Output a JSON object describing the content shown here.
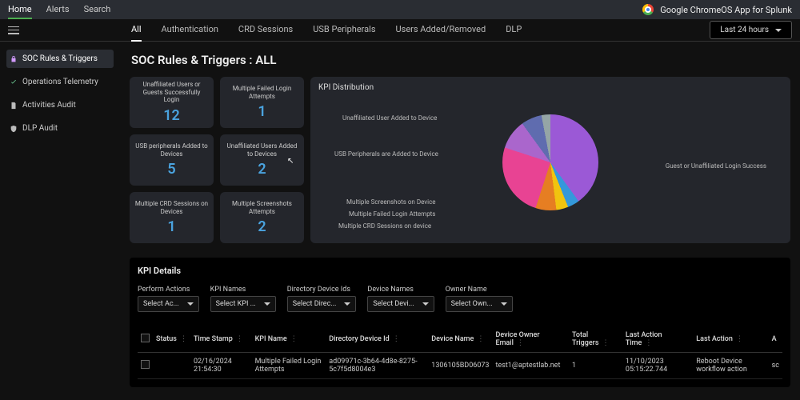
{
  "top_nav": {
    "items": [
      "Home",
      "Alerts",
      "Search"
    ],
    "active": 0
  },
  "app_brand": "Google ChromeOS App for Splunk",
  "tab_bar": {
    "tabs": [
      "All",
      "Authentication",
      "CRD Sessions",
      "USB Peripherals",
      "Users Added/Removed",
      "DLP"
    ],
    "active": 0
  },
  "time_range": "Last 24 hours",
  "sidebar": {
    "items": [
      {
        "label": "SOC Rules & Triggers",
        "icon": "lock-icon",
        "active": true
      },
      {
        "label": "Operations Telemetry",
        "icon": "check-icon",
        "active": false
      },
      {
        "label": "Activities Audit",
        "icon": "doc-icon",
        "active": false
      },
      {
        "label": "DLP Audit",
        "icon": "shield-icon",
        "active": false
      }
    ]
  },
  "page_title": "SOC Rules & Triggers : ALL",
  "kpi_cards": [
    {
      "label": "Unaffiliated Users or Guests Successfully Login",
      "value": "12"
    },
    {
      "label": "Multiple Failed Login Attempts",
      "value": "1"
    },
    {
      "label": "USB peripherals Added to Devices",
      "value": "5"
    },
    {
      "label": "Unaffiliated Users Added to Devices",
      "value": "2"
    },
    {
      "label": "Multiple CRD Sessions on Devices",
      "value": "1"
    },
    {
      "label": "Multiple Screenshots Attempts",
      "value": "2"
    }
  ],
  "kpi_distribution": {
    "title": "KPI Distribution",
    "labels": {
      "right": "Guest or Unaffiliated Login Success",
      "l1": "Unaffiliated User Added to Device",
      "l2": "USB Peripherals are Added to Device",
      "l3": "Multiple Screenshots on Device",
      "l4": "Multiple Failed Login Attempts",
      "l5": "Multiple CRD Sessions on device"
    }
  },
  "details": {
    "title": "KPI Details",
    "filters": [
      {
        "label": "Perform Actions",
        "placeholder": "Select Ac..."
      },
      {
        "label": "KPI Names",
        "placeholder": "Select KPI ..."
      },
      {
        "label": "Directory Device Ids",
        "placeholder": "Select Direc..."
      },
      {
        "label": "Device Names",
        "placeholder": "Select Devi..."
      },
      {
        "label": "Owner Name",
        "placeholder": "Select Own..."
      }
    ],
    "columns": [
      "Status",
      "Time Stamp",
      "KPI Name",
      "Directory Device Id",
      "Device Name",
      "Device Owner Email",
      "Total Triggers",
      "Last Action Time",
      "Last Action",
      "A"
    ],
    "rows": [
      {
        "status": "",
        "timestamp": "02/16/2024 21:54:30",
        "kpi_name": "Multiple Failed Login Attempts",
        "dir_device_id": "ad09971c-3b64-4d8e-8275-5c7f5d8004e3",
        "device_name": "1306105BD06073",
        "owner_email": "test1@aptestlab.net",
        "total_triggers": "1",
        "last_action_time": "11/10/2023 05:15:22.744",
        "last_action": "Reboot Device workflow action",
        "extra": "sc"
      }
    ]
  },
  "chart_data": {
    "type": "pie",
    "title": "KPI Distribution",
    "series": [
      {
        "name": "Guest or Unaffiliated Login Success",
        "value": 12
      },
      {
        "name": "USB Peripherals are Added to Device",
        "value": 5
      },
      {
        "name": "Unaffiliated User Added to Device",
        "value": 2
      },
      {
        "name": "Multiple Screenshots on Device",
        "value": 2
      },
      {
        "name": "Multiple Failed Login Attempts",
        "value": 1
      },
      {
        "name": "Multiple CRD Sessions on device",
        "value": 1
      }
    ]
  }
}
